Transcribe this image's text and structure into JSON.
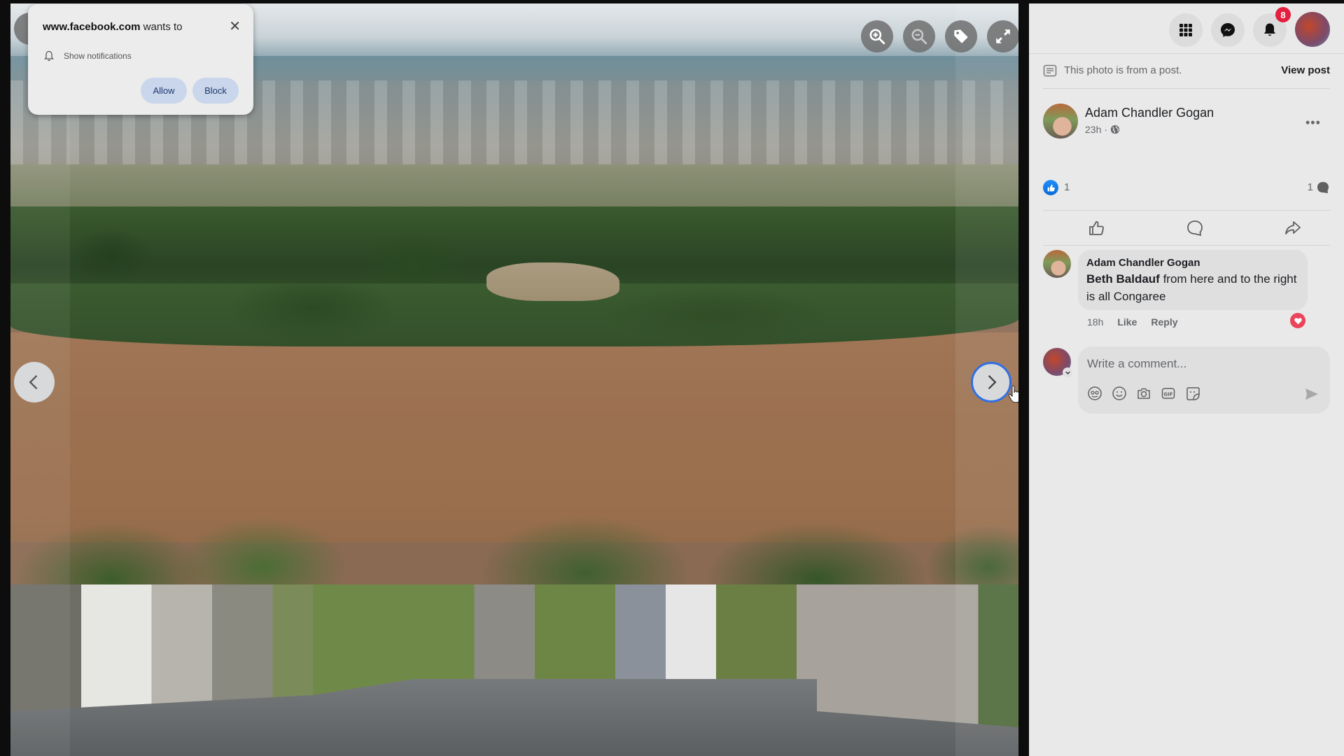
{
  "notification_prompt": {
    "site": "www.facebook.com",
    "wants_to": "wants to",
    "permission": "Show notifications",
    "allow_label": "Allow",
    "block_label": "Block",
    "close_symbol": "✕"
  },
  "viewer": {
    "photo_description": "Aerial view of flooded brown river with city skyline in background and riverside houses in foreground",
    "controls": [
      "zoom-in-icon",
      "zoom-out-icon",
      "tag-icon",
      "fullscreen-icon"
    ],
    "nav": [
      "previous",
      "next"
    ]
  },
  "header": {
    "notification_count": "8",
    "icons": [
      "menu-grid-icon",
      "messenger-icon",
      "bell-icon",
      "profile-avatar"
    ]
  },
  "post": {
    "source_text": "This photo is from a post.",
    "view_post_label": "View post",
    "author": "Adam Chandler Gogan",
    "time": "23h",
    "separator": "·",
    "privacy_icon": "globe-icon",
    "more_label": "•••",
    "reaction_count": "1",
    "comment_count": "1"
  },
  "comment": {
    "author": "Adam Chandler Gogan",
    "mention": "Beth Baldauf",
    "text": " from here and to the right is all Congaree",
    "time": "18h",
    "like_label": "Like",
    "reply_label": "Reply"
  },
  "composer": {
    "placeholder": "Write a comment..."
  },
  "colors": {
    "accent": "#2f6fe4",
    "badge": "#e41e3f",
    "like_blue": "#1877f2",
    "heart_red": "#e9445a",
    "panel_bg": "#e9e9e9"
  }
}
